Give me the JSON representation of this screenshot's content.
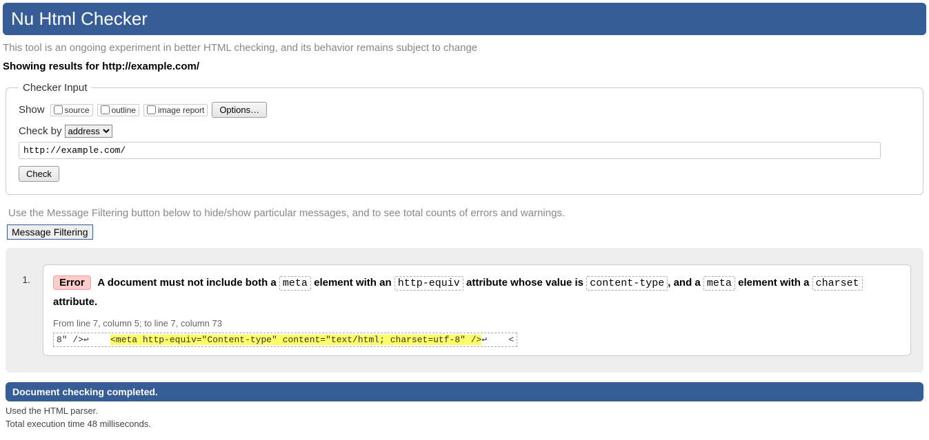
{
  "header": {
    "title": "Nu Html Checker"
  },
  "intro": "This tool is an ongoing experiment in better HTML checking, and its behavior remains subject to change",
  "showing": "Showing results for http://example.com/",
  "checker": {
    "legend": "Checker Input",
    "show_label": "Show",
    "source_label": "source",
    "outline_label": "outline",
    "image_report_label": "image report",
    "options_btn": "Options…",
    "checkby_label": "Check by",
    "checkby_selected": "address",
    "url_value": "http://example.com/",
    "check_btn": "Check"
  },
  "filter": {
    "hint": "Use the Message Filtering button below to hide/show particular messages, and to see total counts of errors and warnings.",
    "btn": "Message Filtering"
  },
  "result": {
    "num": "1.",
    "badge": "Error",
    "msg_p1": "A document must not include both a ",
    "c1": "meta",
    "msg_p2": " element with an ",
    "c2": "http-equiv",
    "msg_p3": " attribute whose value is ",
    "c3": "content-type",
    "msg_p4": ", and a ",
    "c4": "meta",
    "msg_p5": " element with a ",
    "c5": "charset",
    "msg_p6": " attribute.",
    "location": "From line 7, column 5; to line 7, column 73",
    "extract_pre": "8\" />↩    ",
    "extract_hl": "<meta http-equiv=\"Content-type\" content=\"text/html; charset=utf-8\" />",
    "extract_post": "↩    <"
  },
  "completed": "Document checking completed.",
  "footer1": "Used the HTML parser.",
  "footer2": "Total execution time 48 milliseconds."
}
